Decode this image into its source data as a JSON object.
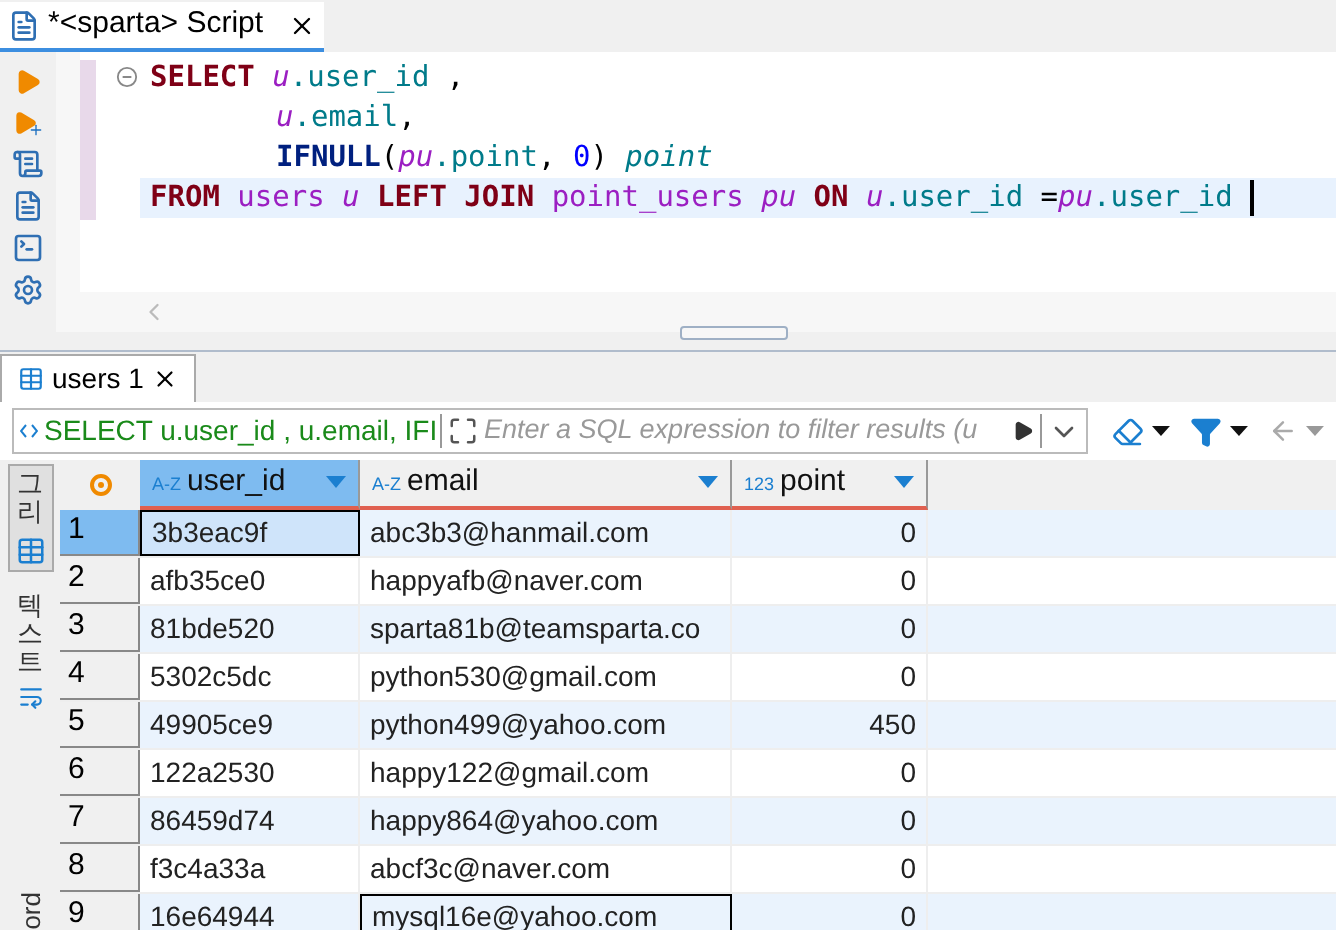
{
  "editor_tab": {
    "title": "*<sparta> Script",
    "selected": true
  },
  "code": [
    {
      "kind": "clause",
      "current": false,
      "tokens": [
        {
          "text": "SELECT",
          "kind": "keyword"
        },
        {
          "text": " u",
          "kind": "alias"
        },
        {
          "text": ".user_id",
          "kind": "column"
        },
        {
          "text": " ,",
          "kind": "punct"
        }
      ]
    },
    {
      "kind": "continuation",
      "current": false,
      "tokens": [
        {
          "text": "u",
          "kind": "alias"
        },
        {
          "text": ".email",
          "kind": "column"
        },
        {
          "text": ",",
          "kind": "punct"
        }
      ]
    },
    {
      "kind": "continuation",
      "current": false,
      "tokens": [
        {
          "text": "IFNULL",
          "kind": "function"
        },
        {
          "text": "(",
          "kind": "punct"
        },
        {
          "text": "pu",
          "kind": "alias"
        },
        {
          "text": ".point",
          "kind": "column"
        },
        {
          "text": ",",
          "kind": "punct"
        },
        {
          "text": " 0",
          "kind": "number"
        },
        {
          "text": ")",
          "kind": "punct"
        },
        {
          "text": " point",
          "kind": "label"
        }
      ]
    },
    {
      "kind": "clause",
      "current": true,
      "tokens": [
        {
          "text": "FROM",
          "kind": "keyword"
        },
        {
          "text": " users",
          "kind": "table"
        },
        {
          "text": " u",
          "kind": "alias"
        },
        {
          "text": " LEFT",
          "kind": "keyword"
        },
        {
          "text": " JOIN",
          "kind": "keyword"
        },
        {
          "text": " point_users",
          "kind": "table"
        },
        {
          "text": " pu",
          "kind": "alias"
        },
        {
          "text": " ON",
          "kind": "keyword"
        },
        {
          "text": " u",
          "kind": "alias"
        },
        {
          "text": ".user_id",
          "kind": "column"
        },
        {
          "text": " =",
          "kind": "punct"
        },
        {
          "text": "pu",
          "kind": "alias"
        },
        {
          "text": ".user_id",
          "kind": "column"
        }
      ]
    }
  ],
  "results_tab": {
    "title": "users 1",
    "selected": true
  },
  "filter": {
    "query": "SELECT u.user_id , u.email, IFI",
    "placeholder": "Enter a SQL expression to filter results (u"
  },
  "side_tabs": [
    {
      "label": "그리",
      "kind": "korean",
      "selected": true
    },
    {
      "label": "텍스트",
      "kind": "korean",
      "selected": false
    },
    {
      "label": "ord",
      "kind": "latin",
      "selected": false
    }
  ],
  "columns": [
    {
      "name": "user_id",
      "type_label": "A-Z",
      "kind": "text",
      "selected": true
    },
    {
      "name": "email",
      "type_label": "A-Z",
      "kind": "text",
      "selected": false
    },
    {
      "name": "point",
      "type_label": "123",
      "kind": "number",
      "selected": false
    }
  ],
  "rows": [
    {
      "number": "1",
      "selected": true,
      "cells": [
        {
          "text": "3b3eac9f",
          "focused": true
        },
        {
          "text": "abc3b3@hanmail.com",
          "focused": false
        },
        {
          "text": "0",
          "focused": false
        }
      ]
    },
    {
      "number": "2",
      "selected": false,
      "cells": [
        {
          "text": "afb35ce0",
          "focused": false
        },
        {
          "text": "happyafb@naver.com",
          "focused": false
        },
        {
          "text": "0",
          "focused": false
        }
      ]
    },
    {
      "number": "3",
      "selected": false,
      "cells": [
        {
          "text": "81bde520",
          "focused": false
        },
        {
          "text": "sparta81b@teamsparta.co",
          "focused": false
        },
        {
          "text": "0",
          "focused": false
        }
      ]
    },
    {
      "number": "4",
      "selected": false,
      "cells": [
        {
          "text": "5302c5dc",
          "focused": false
        },
        {
          "text": "python530@gmail.com",
          "focused": false
        },
        {
          "text": "0",
          "focused": false
        }
      ]
    },
    {
      "number": "5",
      "selected": false,
      "cells": [
        {
          "text": "49905ce9",
          "focused": false
        },
        {
          "text": "python499@yahoo.com",
          "focused": false
        },
        {
          "text": "450",
          "focused": false
        }
      ]
    },
    {
      "number": "6",
      "selected": false,
      "cells": [
        {
          "text": "122a2530",
          "focused": false
        },
        {
          "text": "happy122@gmail.com",
          "focused": false
        },
        {
          "text": "0",
          "focused": false
        }
      ]
    },
    {
      "number": "7",
      "selected": false,
      "cells": [
        {
          "text": "86459d74",
          "focused": false
        },
        {
          "text": "happy864@yahoo.com",
          "focused": false
        },
        {
          "text": "0",
          "focused": false
        }
      ]
    },
    {
      "number": "8",
      "selected": false,
      "cells": [
        {
          "text": "f3c4a33a",
          "focused": false
        },
        {
          "text": "abcf3c@naver.com",
          "focused": false
        },
        {
          "text": "0",
          "focused": false
        }
      ]
    },
    {
      "number": "9",
      "selected": false,
      "cells": [
        {
          "text": "16e64944",
          "focused": false
        },
        {
          "text": "mysql16e@yahoo.com",
          "focused": true
        },
        {
          "text": "0",
          "focused": false
        }
      ]
    }
  ]
}
